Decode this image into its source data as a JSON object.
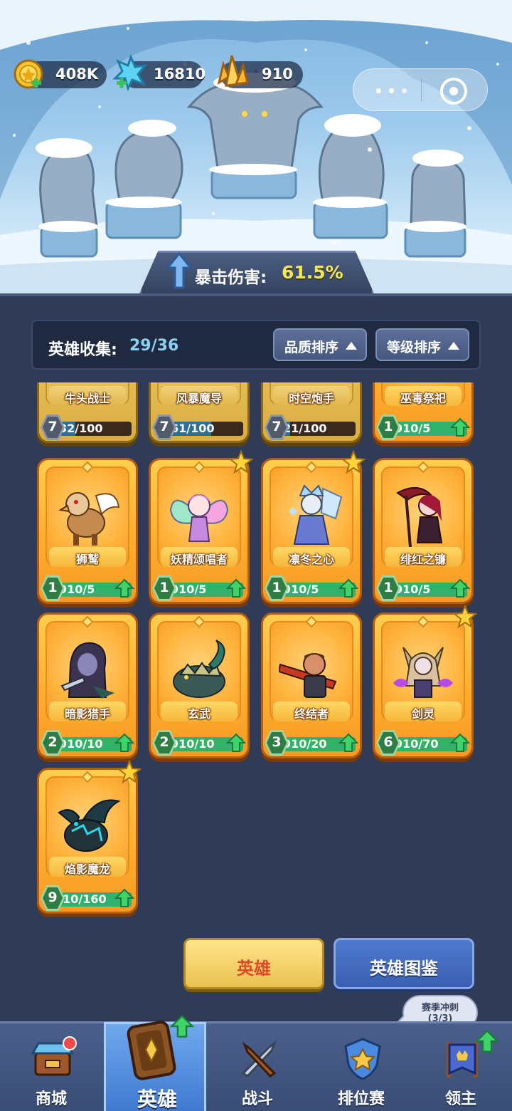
{
  "currency": {
    "gold": "408K",
    "gems": "16810",
    "crystals": "910"
  },
  "banner": {
    "label": "暴击伤害:",
    "value": "61.5%"
  },
  "collection": {
    "label": "英雄收集:",
    "count": "29/36",
    "sort_quality": "品质排序",
    "sort_level": "等级排序"
  },
  "heroes": [
    {
      "name": "牛头战士",
      "level": "7",
      "progress_text": "32/100",
      "progress": 0.32
    },
    {
      "name": "风暴魔导",
      "level": "7",
      "progress_text": "61/100",
      "progress": 0.61
    },
    {
      "name": "时空炮手",
      "level": "7",
      "progress_text": "21/100",
      "progress": 0.21
    },
    {
      "name": "巫毒祭祀",
      "level": "1",
      "progress_text": "910/5",
      "progress": 1.0
    },
    {
      "name": "狮鹫",
      "level": "1",
      "progress_text": "910/5",
      "progress": 1.0
    },
    {
      "name": "妖精颂唱者",
      "level": "1",
      "progress_text": "910/5",
      "progress": 1.0
    },
    {
      "name": "凛冬之心",
      "level": "1",
      "progress_text": "910/5",
      "progress": 1.0
    },
    {
      "name": "绯红之镰",
      "level": "1",
      "progress_text": "910/5",
      "progress": 1.0
    },
    {
      "name": "暗影猎手",
      "level": "2",
      "progress_text": "910/10",
      "progress": 1.0
    },
    {
      "name": "玄武",
      "level": "2",
      "progress_text": "910/10",
      "progress": 1.0
    },
    {
      "name": "终结者",
      "level": "3",
      "progress_text": "910/20",
      "progress": 1.0
    },
    {
      "name": "剑灵",
      "level": "6",
      "progress_text": "910/70",
      "progress": 1.0
    },
    {
      "name": "焰影魔龙",
      "level": "9",
      "progress_text": "910/160",
      "progress": 1.0
    }
  ],
  "buttons": {
    "hero": "英雄",
    "codex": "英雄图鉴"
  },
  "season_bubble": {
    "title": "赛季冲刺",
    "progress": "(3/3)"
  },
  "nav": {
    "shop": "商城",
    "hero": "英雄",
    "battle": "战斗",
    "ranked": "排位赛",
    "lord": "领主"
  },
  "colors": {
    "panel_bg": "#2f3b57",
    "card_orange": "#ffae2f",
    "progress_green": "#2fb36a",
    "crit_value": "#f3e65a",
    "nav_active": "#4f8ae0"
  }
}
